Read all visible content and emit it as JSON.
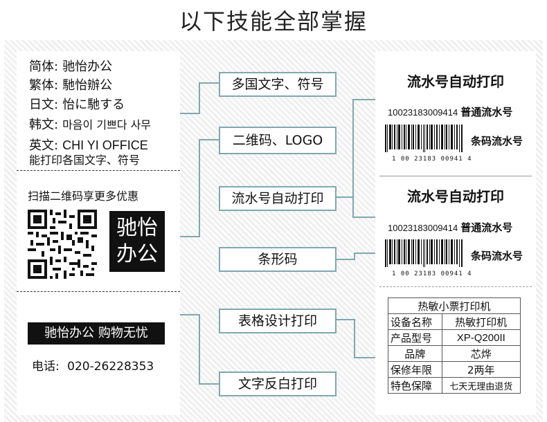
{
  "title": "以下技能全部掌握",
  "left": {
    "rows": [
      {
        "key": "简体:",
        "value": "驰怡办公"
      },
      {
        "key": "繁体:",
        "value": "馳怡辦公"
      },
      {
        "key": "日文:",
        "value": "怡に馳する"
      },
      {
        "key": "韩文:",
        "value": "마음이 기쁘다 사무"
      },
      {
        "key": "英文:",
        "value": "CHI YI OFFICE"
      }
    ],
    "multilang_note": "能打印各国文字、符号",
    "scan_text": "扫描二维码享更多优惠",
    "brand_line1": "驰怡",
    "brand_line2": "办公",
    "slogan": "驰怡办公  购物无忧",
    "phone_label": "电话:",
    "phone_number": "020-26228353"
  },
  "features": [
    "多国文字、符号",
    "二维码、LOGO",
    "流水号自动打印",
    "条形码",
    "表格设计打印",
    "文字反白打印"
  ],
  "right": {
    "serial_title_1": "流水号自动打印",
    "serial_number_1": "10023183009414",
    "serial_label_1": "普通流水号",
    "barcode_label_1": "条码流水号",
    "barcode_digits_1": "1 00 23183 00941 4",
    "serial_title_2": "流水号自动打印",
    "serial_number_2": "10023183009414",
    "serial_label_2": "普通流水号",
    "barcode_label_2": "条码流水号",
    "barcode_digits_2": "1 00 23183 00941 4",
    "table": {
      "header": "热敏小票打印机",
      "rows": [
        {
          "key": "设备名称",
          "value": "热敏打印机"
        },
        {
          "key": "产品型号",
          "value": "XP-Q200II"
        },
        {
          "key": "品牌",
          "value": "芯烨"
        },
        {
          "key": "保修年限",
          "value": "2两年"
        },
        {
          "key": "特色保障",
          "value": "七天无理由退货"
        }
      ]
    }
  },
  "colors": {
    "connector": "#7fa7b2",
    "box_border": "#7fa7b2",
    "hatch": "#ececec"
  }
}
